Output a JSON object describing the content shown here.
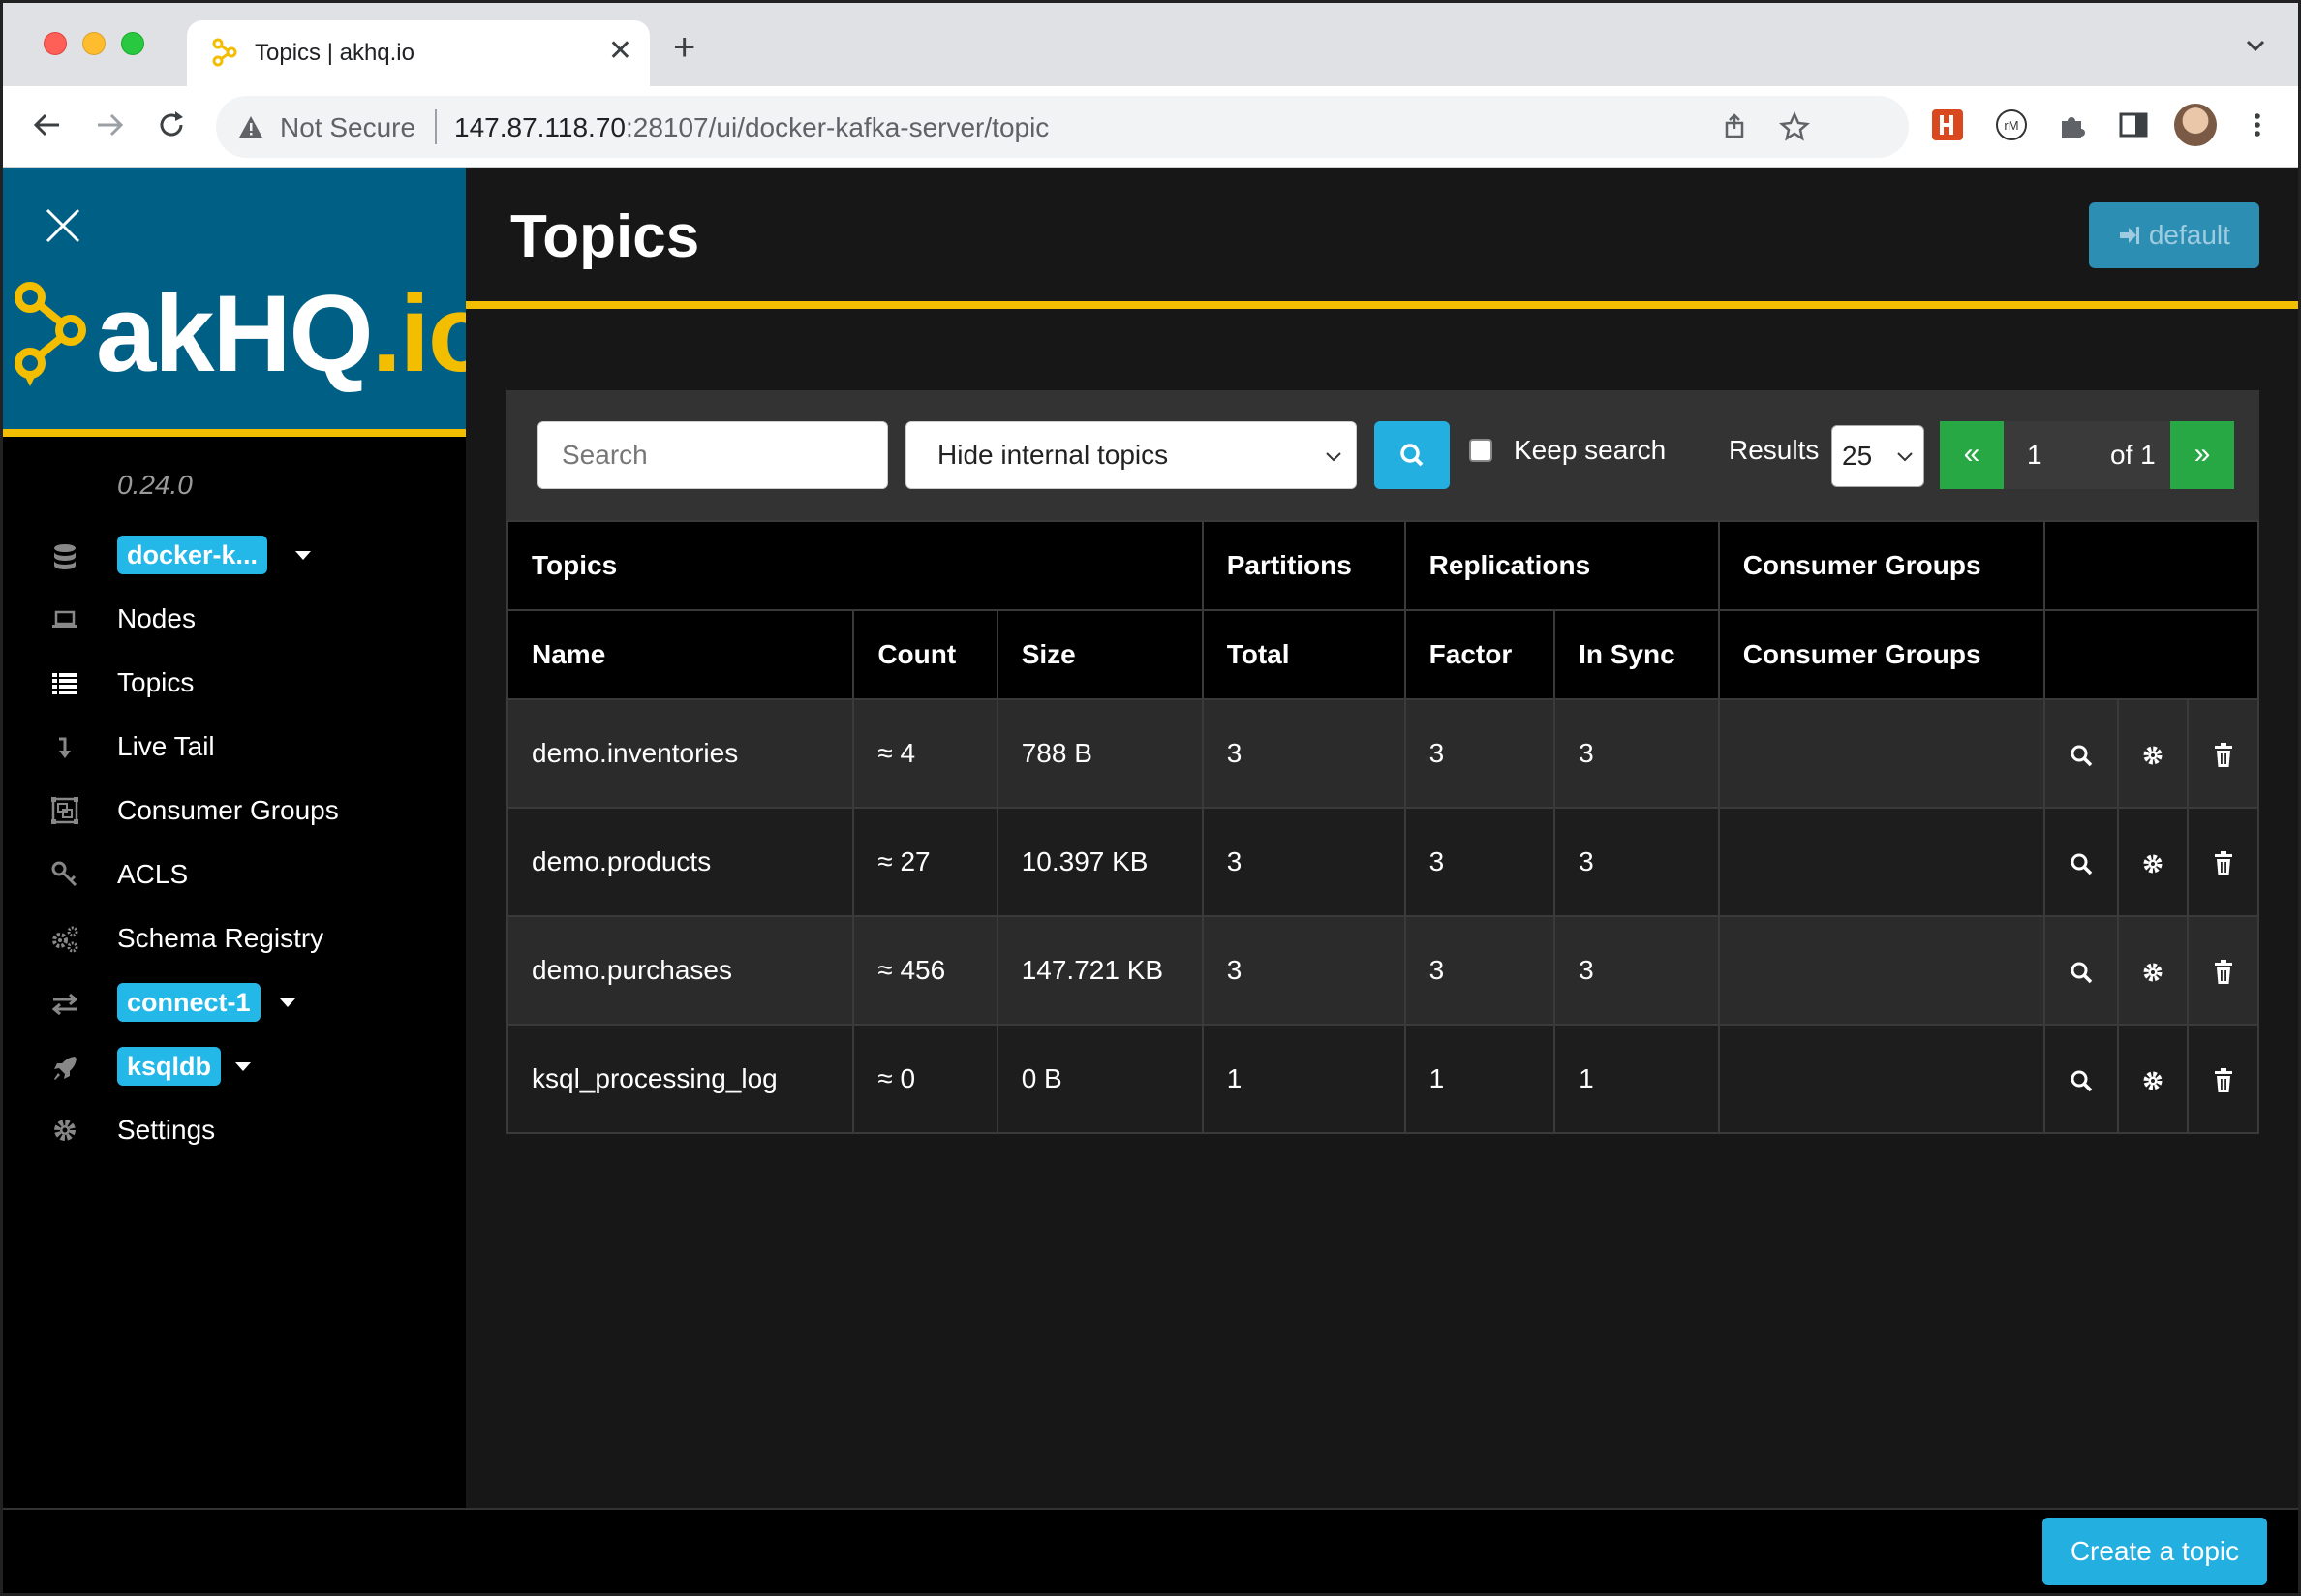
{
  "browser": {
    "tab_title": "Topics | akhq.io",
    "new_tab": "+",
    "security": "Not Secure",
    "url_host": "147.87.118.70",
    "url_rest": ":28107/ui/docker-kafka-server/topic"
  },
  "sidebar": {
    "logo_main": "akHQ",
    "logo_dot": ".io",
    "version": "0.24.0",
    "cluster_pill": "docker-k...",
    "items": {
      "nodes": "Nodes",
      "topics": "Topics",
      "live_tail": "Live Tail",
      "consumer_groups": "Consumer Groups",
      "acls": "ACLS",
      "schema_registry": "Schema Registry",
      "connect_pill": "connect-1",
      "ksqldb_pill": "ksqldb",
      "settings": "Settings"
    }
  },
  "header": {
    "title": "Topics",
    "user_button": "default"
  },
  "filters": {
    "search_placeholder": "Search",
    "topic_filter": "Hide internal topics",
    "keep_search": "Keep search",
    "results_label": "Results",
    "results_value": "25",
    "page_first": "«",
    "page_current": "1",
    "page_of": "of 1",
    "page_last": "»"
  },
  "table": {
    "group_headers": [
      "Topics",
      "Partitions",
      "Replications",
      "Consumer Groups"
    ],
    "columns": [
      "Name",
      "Count",
      "Size",
      "Total",
      "Factor",
      "In Sync",
      "Consumer Groups"
    ],
    "rows": [
      {
        "name": "demo.inventories",
        "count": "≈ 4",
        "size": "788 B",
        "total": "3",
        "factor": "3",
        "in_sync": "3",
        "consumer_groups": ""
      },
      {
        "name": "demo.products",
        "count": "≈ 27",
        "size": "10.397 KB",
        "total": "3",
        "factor": "3",
        "in_sync": "3",
        "consumer_groups": ""
      },
      {
        "name": "demo.purchases",
        "count": "≈ 456",
        "size": "147.721 KB",
        "total": "3",
        "factor": "3",
        "in_sync": "3",
        "consumer_groups": ""
      },
      {
        "name": "ksql_processing_log",
        "count": "≈ 0",
        "size": "0 B",
        "total": "1",
        "factor": "1",
        "in_sync": "1",
        "consumer_groups": ""
      }
    ]
  },
  "footer": {
    "create_button": "Create a topic"
  },
  "colors": {
    "brand_blue": "#005f85",
    "accent_yellow": "#f3bd00",
    "pill_blue": "#23b8e8",
    "pager_green": "#28a745"
  }
}
